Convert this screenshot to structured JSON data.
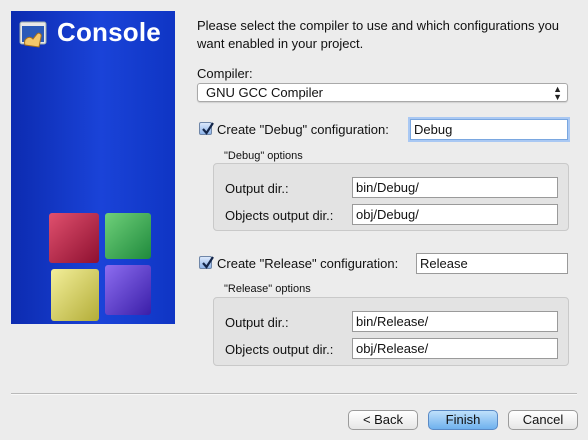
{
  "banner": {
    "title": "Console"
  },
  "intro": "Please select the compiler to use and which configurations you want enabled in your project.",
  "compiler": {
    "label": "Compiler:",
    "value": "GNU GCC Compiler"
  },
  "debug": {
    "checked": true,
    "create_label": "Create \"Debug\" configuration:",
    "name_value": "Debug",
    "options_title": "\"Debug\" options",
    "output_dir_label": "Output dir.:",
    "output_dir_value": "bin/Debug/",
    "objects_dir_label": "Objects output dir.:",
    "objects_dir_value": "obj/Debug/"
  },
  "release": {
    "checked": true,
    "create_label": "Create \"Release\" configuration:",
    "name_value": "Release",
    "options_title": "\"Release\" options",
    "output_dir_label": "Output dir.:",
    "output_dir_value": "bin/Release/",
    "objects_dir_label": "Objects output dir.:",
    "objects_dir_value": "obj/Release/"
  },
  "buttons": {
    "back": "< Back",
    "finish": "Finish",
    "cancel": "Cancel"
  },
  "colors": {
    "banner": "#1a43d8",
    "default_button": "#6fb1ee"
  },
  "icons": [
    "console-app-icon",
    "codeblocks-logo",
    "checkmark-icon",
    "updown-arrows-icon"
  ]
}
